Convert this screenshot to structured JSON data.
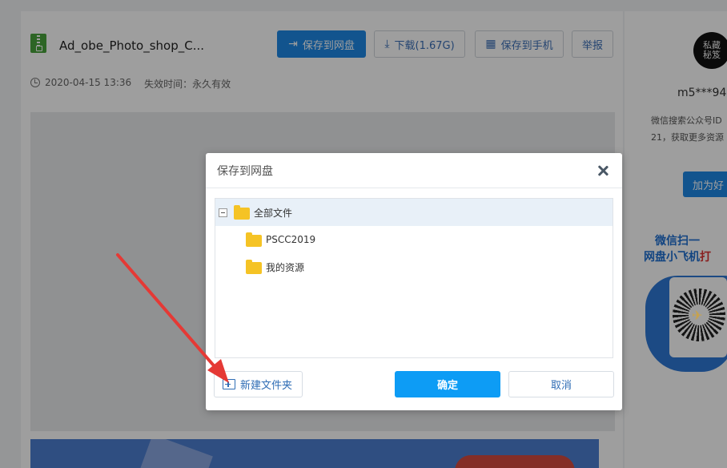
{
  "page": {
    "file": {
      "title": "Ad_obe_Photo_shop_C...",
      "date": "2020-04-15 13:36",
      "expiry": "失效时间：永久有效"
    },
    "actions": {
      "save_to_disk": "保存到网盘",
      "download": "下载(1.67G)",
      "save_to_phone": "保存到手机",
      "report": "举报"
    }
  },
  "sidebar": {
    "avatar_text": "私藏\n秘笈",
    "username": "m5***94",
    "desc_line1": "微信搜索公众号ID",
    "desc_line2": "21，获取更多资源",
    "follow_button": "加为好",
    "scan_line1": "微信扫一",
    "scan_line2_a": "网盘小飞机",
    "scan_line2_b": "打"
  },
  "modal": {
    "title": "保存到网盘",
    "tree": {
      "root": "全部文件",
      "children": [
        "PSCC2019",
        "我的资源"
      ]
    },
    "new_folder": "新建文件夹",
    "confirm": "确定",
    "cancel": "取消"
  },
  "colors": {
    "primary": "#0d9cf5",
    "annotation_arrow": "#e53935"
  }
}
